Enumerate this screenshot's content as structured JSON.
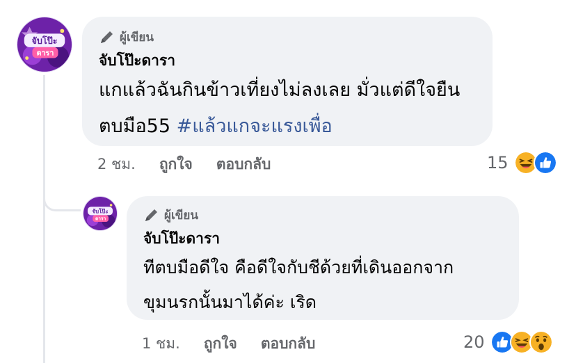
{
  "comment": {
    "author_badge": "ผู้เขียน",
    "author_name": "จับโป๊ะดารา",
    "text_line1": "แกแล้วฉันกินข้าวเที่ยงไม่ลงเลย มั่วแต่ดีใจยืน",
    "text_line2_plain": "ตบมือ55 ",
    "hashtag": "#แล้วแกจะแรงเพื่อ",
    "time": "2 ชม.",
    "like_label": "ถูกใจ",
    "reply_label": "ตอบกลับ",
    "reaction_count": "15",
    "reaction_icons": [
      "haha-icon",
      "like-icon"
    ]
  },
  "reply": {
    "author_badge": "ผู้เขียน",
    "author_name": "จับโป๊ะดารา",
    "text_line1": "ทีตบมือดีใจ คือดีใจกับชีด้วยที่เดินออกจาก",
    "text_line2": "ขุมนรกนั้นมาได้ค่ะ เริด",
    "time": "1 ชม.",
    "like_label": "ถูกใจ",
    "reply_label": "ตอบกลับ",
    "reaction_count": "20",
    "reaction_icons": [
      "like-icon",
      "haha-icon",
      "wow-icon"
    ]
  },
  "avatar_logo_text": "จับโป๊ะดารา",
  "colors": {
    "bubble": "#f0f2f5",
    "text": "#050505",
    "muted": "#65676b",
    "hashtag": "#385898",
    "like_blue": "#1877f2",
    "emoji_yellow": "#f7b125"
  }
}
